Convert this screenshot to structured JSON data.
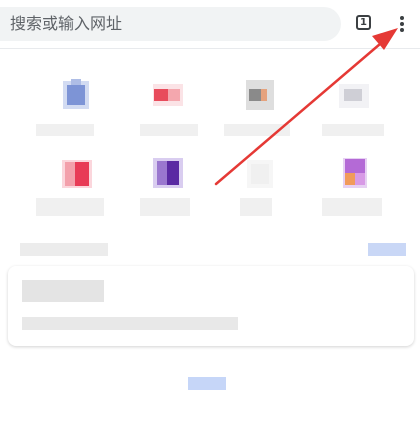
{
  "omnibox": {
    "placeholder": "搜索或输入网址"
  },
  "tab_switcher": {
    "count": "1"
  },
  "menu": {
    "icon": "more-vert-icon"
  },
  "annotation": {
    "color": "#e53935",
    "icon": "red-arrow"
  },
  "shortcuts": [
    {
      "icon": "shortcut-1-icon",
      "colors": [
        "#aebde6",
        "#7d94d6",
        "#d2dbf2"
      ]
    },
    {
      "icon": "shortcut-2-icon",
      "colors": [
        "#e84c5c",
        "#f4a7ae",
        "#fbe3e6"
      ]
    },
    {
      "icon": "shortcut-3-icon",
      "colors": [
        "#8a8a8a",
        "#e5a27d",
        "#dedede"
      ]
    },
    {
      "icon": "shortcut-4-icon",
      "colors": [
        "#cfcfd6",
        "#e8e8ee",
        "#f2f2f5"
      ]
    },
    {
      "icon": "shortcut-5-icon",
      "colors": [
        "#e83b56",
        "#f3a0ab",
        "#fbd6dc"
      ]
    },
    {
      "icon": "shortcut-6-icon",
      "colors": [
        "#5a2aa3",
        "#9a77cf",
        "#d9cdf0"
      ]
    },
    {
      "icon": "shortcut-7-icon",
      "colors": [
        "#f0f0f0",
        "#e8e8e8",
        "#f6f6f6"
      ]
    },
    {
      "icon": "shortcut-8-icon",
      "colors": [
        "#b46ad6",
        "#f19b5b",
        "#e7d1f3"
      ]
    }
  ]
}
